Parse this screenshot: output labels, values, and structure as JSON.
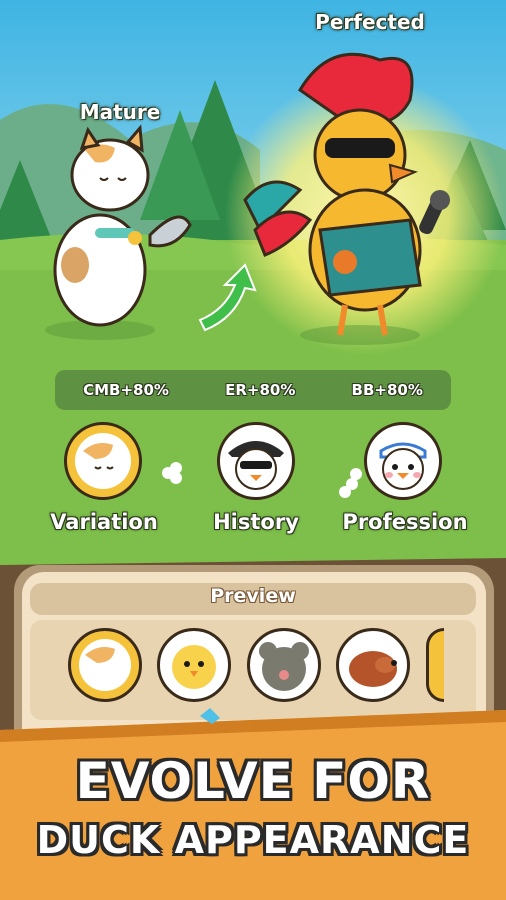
{
  "stages": {
    "left_label": "Mature",
    "right_label": "Perfected"
  },
  "stats": [
    "CMB+80%",
    "ER+80%",
    "BB+80%"
  ],
  "options": {
    "variation": "Variation",
    "history": "History",
    "profession": "Profession"
  },
  "preview": {
    "title": "Preview",
    "items": [
      "calico-cat-icon",
      "yellow-chick-icon",
      "gray-mouse-icon",
      "brown-dog-icon",
      "partial-icon"
    ]
  },
  "banner": {
    "line1": "EVOLVE FOR",
    "line2": "DUCK APPEARANCE"
  },
  "colors": {
    "sky": "#5cc3e6",
    "grass": "#7dbf4a",
    "panel": "#f3e2c6",
    "banner": "#f0a23e",
    "accent_red": "#e8293c",
    "gold": "#f5c33b"
  }
}
